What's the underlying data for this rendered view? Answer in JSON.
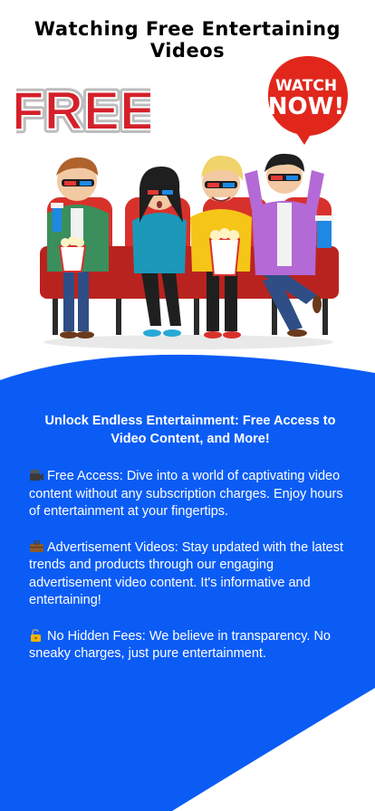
{
  "page": {
    "title_line1": "Watching Free Entertaining",
    "title_line2": "Videos"
  },
  "badges": {
    "free_text": "FREE",
    "watch_line1": "WATCH",
    "watch_line2": "NOW!"
  },
  "illustration": {
    "subject": "four-friends-in-cinema-seats-with-3d-glasses"
  },
  "content": {
    "headline_line1": "Unlock Endless Entertainment: Free Access to",
    "headline_line2": "Video Content, and More!",
    "items": [
      {
        "icon": "movie-camera-icon",
        "text": "Free Access: Dive into a world of captivating video content without any subscription charges. Enjoy hours of entertainment at your fingertips."
      },
      {
        "icon": "briefcase-icon",
        "text": "Advertisement Videos: Stay updated with the latest trends and products through our engaging advertisement video content. It's informative and entertaining!"
      },
      {
        "icon": "unlocked-padlock-icon",
        "text": "No Hidden Fees: We believe in transparency. No sneaky charges, just pure entertainment."
      }
    ]
  },
  "colors": {
    "panel_blue": "#0b5cf5",
    "free_red": "#d4202a",
    "watch_red": "#e1271c",
    "seat_red": "#d8312c"
  }
}
